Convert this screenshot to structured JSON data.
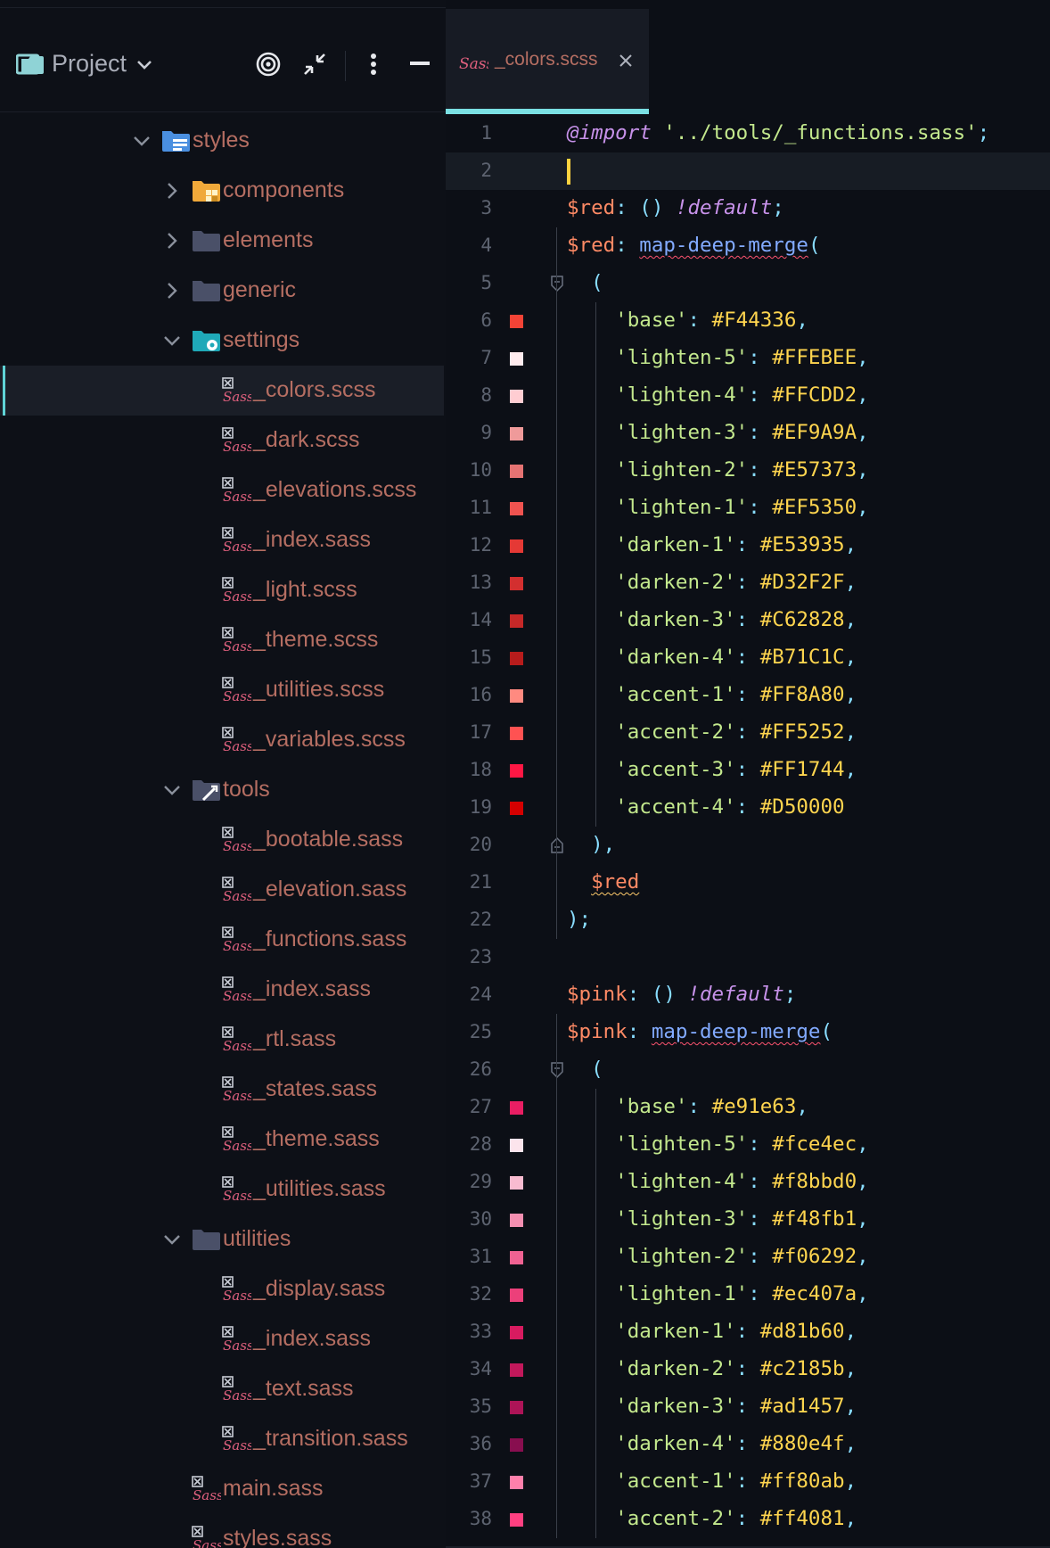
{
  "project": {
    "title": "Project",
    "tree": [
      {
        "label": "styles",
        "indent": 0,
        "kind": "folder-styles",
        "expanded": true
      },
      {
        "label": "components",
        "indent": 1,
        "kind": "folder-components",
        "expanded": false
      },
      {
        "label": "elements",
        "indent": 1,
        "kind": "folder",
        "expanded": false
      },
      {
        "label": "generic",
        "indent": 1,
        "kind": "folder",
        "expanded": false
      },
      {
        "label": "settings",
        "indent": 1,
        "kind": "folder-settings",
        "expanded": true
      },
      {
        "label": "_colors.scss",
        "indent": 2,
        "kind": "sass",
        "selected": true
      },
      {
        "label": "_dark.scss",
        "indent": 2,
        "kind": "sass"
      },
      {
        "label": "_elevations.scss",
        "indent": 2,
        "kind": "sass"
      },
      {
        "label": "_index.sass",
        "indent": 2,
        "kind": "sass"
      },
      {
        "label": "_light.scss",
        "indent": 2,
        "kind": "sass"
      },
      {
        "label": "_theme.scss",
        "indent": 2,
        "kind": "sass"
      },
      {
        "label": "_utilities.scss",
        "indent": 2,
        "kind": "sass"
      },
      {
        "label": "_variables.scss",
        "indent": 2,
        "kind": "sass"
      },
      {
        "label": "tools",
        "indent": 1,
        "kind": "folder-tools",
        "expanded": true
      },
      {
        "label": "_bootable.sass",
        "indent": 2,
        "kind": "sass"
      },
      {
        "label": "_elevation.sass",
        "indent": 2,
        "kind": "sass"
      },
      {
        "label": "_functions.sass",
        "indent": 2,
        "kind": "sass"
      },
      {
        "label": "_index.sass",
        "indent": 2,
        "kind": "sass"
      },
      {
        "label": "_rtl.sass",
        "indent": 2,
        "kind": "sass"
      },
      {
        "label": "_states.sass",
        "indent": 2,
        "kind": "sass"
      },
      {
        "label": "_theme.sass",
        "indent": 2,
        "kind": "sass"
      },
      {
        "label": "_utilities.sass",
        "indent": 2,
        "kind": "sass"
      },
      {
        "label": "utilities",
        "indent": 1,
        "kind": "folder",
        "expanded": true
      },
      {
        "label": "_display.sass",
        "indent": 2,
        "kind": "sass"
      },
      {
        "label": "_index.sass",
        "indent": 2,
        "kind": "sass"
      },
      {
        "label": "_text.sass",
        "indent": 2,
        "kind": "sass"
      },
      {
        "label": "_transition.sass",
        "indent": 2,
        "kind": "sass"
      },
      {
        "label": "main.sass",
        "indent": 1,
        "kind": "sass-noarrow"
      },
      {
        "label": "styles.sass",
        "indent": 1,
        "kind": "sass-noarrow"
      }
    ]
  },
  "editor": {
    "tab_label": "_colors.scss",
    "current_line": 2,
    "lines": [
      {
        "n": "1",
        "tokens": [
          [
            "imp",
            "@import"
          ],
          [
            "pun",
            " "
          ],
          [
            "str",
            "'../tools/_functions.sass'"
          ],
          [
            "pun",
            ";"
          ]
        ]
      },
      {
        "n": "2",
        "tokens": []
      },
      {
        "n": "3",
        "tokens": [
          [
            "var",
            "$red"
          ],
          [
            "pun",
            ": () "
          ],
          [
            "dir",
            "!default"
          ],
          [
            "pun",
            ";"
          ]
        ]
      },
      {
        "n": "4",
        "tokens": [
          [
            "var",
            "$red"
          ],
          [
            "pun",
            ": "
          ],
          [
            "fn",
            "map-deep-merge"
          ],
          [
            "pun",
            "("
          ]
        ]
      },
      {
        "n": "5",
        "tokens": [
          [
            "pun",
            "  ("
          ]
        ],
        "fold": "open"
      },
      {
        "n": "6",
        "tokens": [
          [
            "key",
            "    'base'"
          ],
          [
            "pun",
            ": "
          ],
          [
            "hex",
            "#F44336"
          ],
          [
            "pun",
            ","
          ]
        ],
        "swatch": "#F44336"
      },
      {
        "n": "7",
        "tokens": [
          [
            "key",
            "    'lighten-5'"
          ],
          [
            "pun",
            ": "
          ],
          [
            "hex",
            "#FFEBEE"
          ],
          [
            "pun",
            ","
          ]
        ],
        "swatch": "#FFEBEE"
      },
      {
        "n": "8",
        "tokens": [
          [
            "key",
            "    'lighten-4'"
          ],
          [
            "pun",
            ": "
          ],
          [
            "hex",
            "#FFCDD2"
          ],
          [
            "pun",
            ","
          ]
        ],
        "swatch": "#FFCDD2"
      },
      {
        "n": "9",
        "tokens": [
          [
            "key",
            "    'lighten-3'"
          ],
          [
            "pun",
            ": "
          ],
          [
            "hex",
            "#EF9A9A"
          ],
          [
            "pun",
            ","
          ]
        ],
        "swatch": "#EF9A9A"
      },
      {
        "n": "10",
        "tokens": [
          [
            "key",
            "    'lighten-2'"
          ],
          [
            "pun",
            ": "
          ],
          [
            "hex",
            "#E57373"
          ],
          [
            "pun",
            ","
          ]
        ],
        "swatch": "#E57373"
      },
      {
        "n": "11",
        "tokens": [
          [
            "key",
            "    'lighten-1'"
          ],
          [
            "pun",
            ": "
          ],
          [
            "hex",
            "#EF5350"
          ],
          [
            "pun",
            ","
          ]
        ],
        "swatch": "#EF5350"
      },
      {
        "n": "12",
        "tokens": [
          [
            "key",
            "    'darken-1'"
          ],
          [
            "pun",
            ": "
          ],
          [
            "hex",
            "#E53935"
          ],
          [
            "pun",
            ","
          ]
        ],
        "swatch": "#E53935"
      },
      {
        "n": "13",
        "tokens": [
          [
            "key",
            "    'darken-2'"
          ],
          [
            "pun",
            ": "
          ],
          [
            "hex",
            "#D32F2F"
          ],
          [
            "pun",
            ","
          ]
        ],
        "swatch": "#D32F2F"
      },
      {
        "n": "14",
        "tokens": [
          [
            "key",
            "    'darken-3'"
          ],
          [
            "pun",
            ": "
          ],
          [
            "hex",
            "#C62828"
          ],
          [
            "pun",
            ","
          ]
        ],
        "swatch": "#C62828"
      },
      {
        "n": "15",
        "tokens": [
          [
            "key",
            "    'darken-4'"
          ],
          [
            "pun",
            ": "
          ],
          [
            "hex",
            "#B71C1C"
          ],
          [
            "pun",
            ","
          ]
        ],
        "swatch": "#B71C1C"
      },
      {
        "n": "16",
        "tokens": [
          [
            "key",
            "    'accent-1'"
          ],
          [
            "pun",
            ": "
          ],
          [
            "hex",
            "#FF8A80"
          ],
          [
            "pun",
            ","
          ]
        ],
        "swatch": "#FF8A80"
      },
      {
        "n": "17",
        "tokens": [
          [
            "key",
            "    'accent-2'"
          ],
          [
            "pun",
            ": "
          ],
          [
            "hex",
            "#FF5252"
          ],
          [
            "pun",
            ","
          ]
        ],
        "swatch": "#FF5252"
      },
      {
        "n": "18",
        "tokens": [
          [
            "key",
            "    'accent-3'"
          ],
          [
            "pun",
            ": "
          ],
          [
            "hex",
            "#FF1744"
          ],
          [
            "pun",
            ","
          ]
        ],
        "swatch": "#FF1744"
      },
      {
        "n": "19",
        "tokens": [
          [
            "key",
            "    'accent-4'"
          ],
          [
            "pun",
            ": "
          ],
          [
            "hex",
            "#D50000"
          ]
        ],
        "swatch": "#D50000"
      },
      {
        "n": "20",
        "tokens": [
          [
            "pun",
            "  ),"
          ]
        ],
        "fold": "close"
      },
      {
        "n": "21",
        "tokens": [
          [
            "pun",
            "  "
          ],
          [
            "wavy",
            "$red"
          ]
        ]
      },
      {
        "n": "22",
        "tokens": [
          [
            "pun",
            ");"
          ]
        ]
      },
      {
        "n": "23",
        "tokens": []
      },
      {
        "n": "24",
        "tokens": [
          [
            "var",
            "$pink"
          ],
          [
            "pun",
            ": () "
          ],
          [
            "dir",
            "!default"
          ],
          [
            "pun",
            ";"
          ]
        ]
      },
      {
        "n": "25",
        "tokens": [
          [
            "var",
            "$pink"
          ],
          [
            "pun",
            ": "
          ],
          [
            "fn",
            "map-deep-merge"
          ],
          [
            "pun",
            "("
          ]
        ]
      },
      {
        "n": "26",
        "tokens": [
          [
            "pun",
            "  ("
          ]
        ],
        "fold": "open"
      },
      {
        "n": "27",
        "tokens": [
          [
            "key",
            "    'base'"
          ],
          [
            "pun",
            ": "
          ],
          [
            "hex",
            "#e91e63"
          ],
          [
            "pun",
            ","
          ]
        ],
        "swatch": "#e91e63"
      },
      {
        "n": "28",
        "tokens": [
          [
            "key",
            "    'lighten-5'"
          ],
          [
            "pun",
            ": "
          ],
          [
            "hex",
            "#fce4ec"
          ],
          [
            "pun",
            ","
          ]
        ],
        "swatch": "#fce4ec"
      },
      {
        "n": "29",
        "tokens": [
          [
            "key",
            "    'lighten-4'"
          ],
          [
            "pun",
            ": "
          ],
          [
            "hex",
            "#f8bbd0"
          ],
          [
            "pun",
            ","
          ]
        ],
        "swatch": "#f8bbd0"
      },
      {
        "n": "30",
        "tokens": [
          [
            "key",
            "    'lighten-3'"
          ],
          [
            "pun",
            ": "
          ],
          [
            "hex",
            "#f48fb1"
          ],
          [
            "pun",
            ","
          ]
        ],
        "swatch": "#f48fb1"
      },
      {
        "n": "31",
        "tokens": [
          [
            "key",
            "    'lighten-2'"
          ],
          [
            "pun",
            ": "
          ],
          [
            "hex",
            "#f06292"
          ],
          [
            "pun",
            ","
          ]
        ],
        "swatch": "#f06292"
      },
      {
        "n": "32",
        "tokens": [
          [
            "key",
            "    'lighten-1'"
          ],
          [
            "pun",
            ": "
          ],
          [
            "hex",
            "#ec407a"
          ],
          [
            "pun",
            ","
          ]
        ],
        "swatch": "#ec407a"
      },
      {
        "n": "33",
        "tokens": [
          [
            "key",
            "    'darken-1'"
          ],
          [
            "pun",
            ": "
          ],
          [
            "hex",
            "#d81b60"
          ],
          [
            "pun",
            ","
          ]
        ],
        "swatch": "#d81b60"
      },
      {
        "n": "34",
        "tokens": [
          [
            "key",
            "    'darken-2'"
          ],
          [
            "pun",
            ": "
          ],
          [
            "hex",
            "#c2185b"
          ],
          [
            "pun",
            ","
          ]
        ],
        "swatch": "#c2185b"
      },
      {
        "n": "35",
        "tokens": [
          [
            "key",
            "    'darken-3'"
          ],
          [
            "pun",
            ": "
          ],
          [
            "hex",
            "#ad1457"
          ],
          [
            "pun",
            ","
          ]
        ],
        "swatch": "#ad1457"
      },
      {
        "n": "36",
        "tokens": [
          [
            "key",
            "    'darken-4'"
          ],
          [
            "pun",
            ": "
          ],
          [
            "hex",
            "#880e4f"
          ],
          [
            "pun",
            ","
          ]
        ],
        "swatch": "#880e4f"
      },
      {
        "n": "37",
        "tokens": [
          [
            "key",
            "    'accent-1'"
          ],
          [
            "pun",
            ": "
          ],
          [
            "hex",
            "#ff80ab"
          ],
          [
            "pun",
            ","
          ]
        ],
        "swatch": "#ff80ab"
      },
      {
        "n": "38",
        "tokens": [
          [
            "key",
            "    'accent-2'"
          ],
          [
            "pun",
            ": "
          ],
          [
            "hex",
            "#ff4081"
          ],
          [
            "pun",
            ","
          ]
        ],
        "swatch": "#ff4081"
      }
    ]
  },
  "icons": {
    "project_folder": "project-folder-icon",
    "chevron": "chevron-down-icon",
    "locate": "target-icon",
    "collapse": "collapse-arrows-icon",
    "more": "more-vertical-icon",
    "hide": "minimize-icon",
    "sass": "sass-file-icon",
    "close": "close-icon"
  }
}
